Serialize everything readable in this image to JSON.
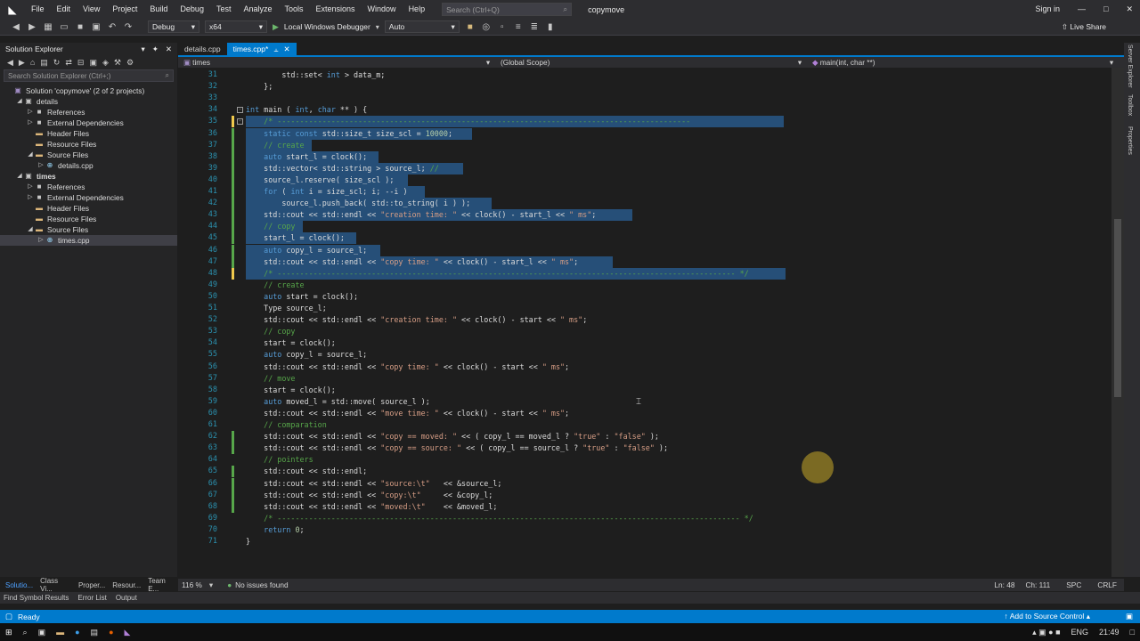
{
  "titlebar": {
    "menu": [
      "File",
      "Edit",
      "View",
      "Project",
      "Build",
      "Debug",
      "Test",
      "Analyze",
      "Tools",
      "Extensions",
      "Window",
      "Help"
    ],
    "search_placeholder": "Search (Ctrl+Q)",
    "solution_name": "copymove",
    "signin": "Sign in",
    "window_buttons": [
      "—",
      "❐",
      "✕"
    ]
  },
  "toolbar": {
    "config": "Debug",
    "platform": "x64",
    "debugger": "Local Windows Debugger",
    "debugger_mode": "Auto",
    "live_share": "Live Share"
  },
  "solution_explorer": {
    "title": "Solution Explorer",
    "search_placeholder": "Search Solution Explorer (Ctrl+;)",
    "tree": [
      {
        "label": "Solution 'copymove' (2 of 2 projects)",
        "level": 0,
        "arrow": "",
        "icon": "solution-icon",
        "glyph": "▣",
        "color": "#9f8bc2"
      },
      {
        "label": "details",
        "level": 1,
        "arrow": "◢",
        "icon": "project-icon",
        "glyph": "▣",
        "color": "#c6c6c6",
        "bold": false
      },
      {
        "label": "References",
        "level": 2,
        "arrow": "▷",
        "icon": "references-icon",
        "glyph": "■",
        "color": "#c6c6c6"
      },
      {
        "label": "External Dependencies",
        "level": 2,
        "arrow": "▷",
        "icon": "dependencies-icon",
        "glyph": "■",
        "color": "#c6c6c6"
      },
      {
        "label": "Header Files",
        "level": 2,
        "arrow": "",
        "icon": "folder-icon",
        "glyph": "▬",
        "color": "#dcb67a"
      },
      {
        "label": "Resource Files",
        "level": 2,
        "arrow": "",
        "icon": "folder-icon",
        "glyph": "▬",
        "color": "#dcb67a"
      },
      {
        "label": "Source Files",
        "level": 2,
        "arrow": "◢",
        "icon": "folder-icon",
        "glyph": "▬",
        "color": "#dcb67a"
      },
      {
        "label": "details.cpp",
        "level": 3,
        "arrow": "▷",
        "icon": "cpp-file-icon",
        "glyph": "⊕",
        "color": "#9cdcfe"
      },
      {
        "label": "times",
        "level": 1,
        "arrow": "◢",
        "icon": "project-icon",
        "glyph": "▣",
        "color": "#c6c6c6",
        "bold": true
      },
      {
        "label": "References",
        "level": 2,
        "arrow": "▷",
        "icon": "references-icon",
        "glyph": "■",
        "color": "#c6c6c6"
      },
      {
        "label": "External Dependencies",
        "level": 2,
        "arrow": "▷",
        "icon": "dependencies-icon",
        "glyph": "■",
        "color": "#c6c6c6"
      },
      {
        "label": "Header Files",
        "level": 2,
        "arrow": "",
        "icon": "folder-icon",
        "glyph": "▬",
        "color": "#dcb67a"
      },
      {
        "label": "Resource Files",
        "level": 2,
        "arrow": "",
        "icon": "folder-icon",
        "glyph": "▬",
        "color": "#dcb67a"
      },
      {
        "label": "Source Files",
        "level": 2,
        "arrow": "◢",
        "icon": "folder-icon",
        "glyph": "▬",
        "color": "#dcb67a"
      },
      {
        "label": "times.cpp",
        "level": 3,
        "arrow": "▷",
        "icon": "cpp-file-icon",
        "glyph": "⊕",
        "color": "#9cdcfe",
        "selected": true
      }
    ],
    "bottom_tabs": [
      "Solutio...",
      "Class Vi...",
      "Proper...",
      "Resour...",
      "Team E..."
    ]
  },
  "editor": {
    "tabs": [
      {
        "label": "details.cpp",
        "active": false
      },
      {
        "label": "times.cpp*",
        "active": true
      }
    ],
    "nav_project": "times",
    "nav_scope": "(Global Scope)",
    "nav_member": "main(int, char **)",
    "lines": [
      {
        "n": "31",
        "html": "        std::set< int > data_m;"
      },
      {
        "n": "32",
        "html": "    };"
      },
      {
        "n": "33",
        "html": ""
      },
      {
        "n": "34",
        "html": "int main ( int, char ** ) {"
      },
      {
        "n": "35",
        "html": "    /* --------------------------------------------------------------------------------------------"
      },
      {
        "n": "36",
        "html": "    static const std::size_t size_scl = 10000;"
      },
      {
        "n": "37",
        "html": "    // create"
      },
      {
        "n": "38",
        "html": "    auto start_l = clock();"
      },
      {
        "n": "39",
        "html": "    std::vector< std::string > source_l; //"
      },
      {
        "n": "40",
        "html": "    source_l.reserve( size_scl );"
      },
      {
        "n": "41",
        "html": "    for ( int i = size_scl; i; --i )"
      },
      {
        "n": "42",
        "html": "        source_l.push_back( std::to_string( i ) );"
      },
      {
        "n": "43",
        "html": "    std::cout << std::endl << \"creation time: \" << clock() - start_l << \" ms\";"
      },
      {
        "n": "44",
        "html": "    // copy"
      },
      {
        "n": "45",
        "html": "    start_l = clock();"
      },
      {
        "n": "46",
        "html": "    auto copy_l = source_l;"
      },
      {
        "n": "47",
        "html": "    std::cout << std::endl << \"copy time: \" << clock() - start_l << \" ms\";"
      },
      {
        "n": "48",
        "html": "    /* ------------------------------------------------------------------------------------------------------ */"
      },
      {
        "n": "49",
        "html": "    // create"
      },
      {
        "n": "50",
        "html": "    auto start = clock();"
      },
      {
        "n": "51",
        "html": "    Type source_l;"
      },
      {
        "n": "52",
        "html": "    std::cout << std::endl << \"creation time: \" << clock() - start << \" ms\";"
      },
      {
        "n": "53",
        "html": "    // copy"
      },
      {
        "n": "54",
        "html": "    start = clock();"
      },
      {
        "n": "55",
        "html": "    auto copy_l = source_l;"
      },
      {
        "n": "56",
        "html": "    std::cout << std::endl << \"copy time: \" << clock() - start << \" ms\";"
      },
      {
        "n": "57",
        "html": "    // move"
      },
      {
        "n": "58",
        "html": "    start = clock();"
      },
      {
        "n": "59",
        "html": "    auto moved_l = std::move( source_l );"
      },
      {
        "n": "60",
        "html": "    std::cout << std::endl << \"move time: \" << clock() - start << \" ms\";"
      },
      {
        "n": "61",
        "html": "    // comparation"
      },
      {
        "n": "62",
        "html": "    std::cout << std::endl << \"copy == moved: \" << ( copy_l == moved_l ? \"true\" : \"false\" );"
      },
      {
        "n": "63",
        "html": "    std::cout << std::endl << \"copy == source: \" << ( copy_l == source_l ? \"true\" : \"false\" );"
      },
      {
        "n": "64",
        "html": "    // pointers"
      },
      {
        "n": "65",
        "html": "    std::cout << std::endl;"
      },
      {
        "n": "66",
        "html": "    std::cout << std::endl << \"source:\\t\"   << &source_l;"
      },
      {
        "n": "67",
        "html": "    std::cout << std::endl << \"copy:\\t\"     << &copy_l;"
      },
      {
        "n": "68",
        "html": "    std::cout << std::endl << \"moved:\\t\"    << &moved_l;"
      },
      {
        "n": "69",
        "html": "    /* ------------------------------------------------------------------------------------------------------- */"
      },
      {
        "n": "70",
        "html": "    return 0;"
      },
      {
        "n": "71",
        "html": "}"
      }
    ],
    "zoom": "116 %",
    "issues": "No issues found",
    "ln": "Ln: 48",
    "ch": "Ch: 111",
    "spc": "SPC",
    "crlf": "CRLF"
  },
  "right_rail": [
    "Server Explorer",
    "Toolbox",
    "Properties"
  ],
  "output_tabs": [
    "Find Symbol Results",
    "Error List",
    "Output"
  ],
  "status": {
    "ready": "Ready",
    "source_control": "Add to Source Control"
  },
  "taskbar": {
    "lang": "ENG",
    "time": "21:49"
  }
}
